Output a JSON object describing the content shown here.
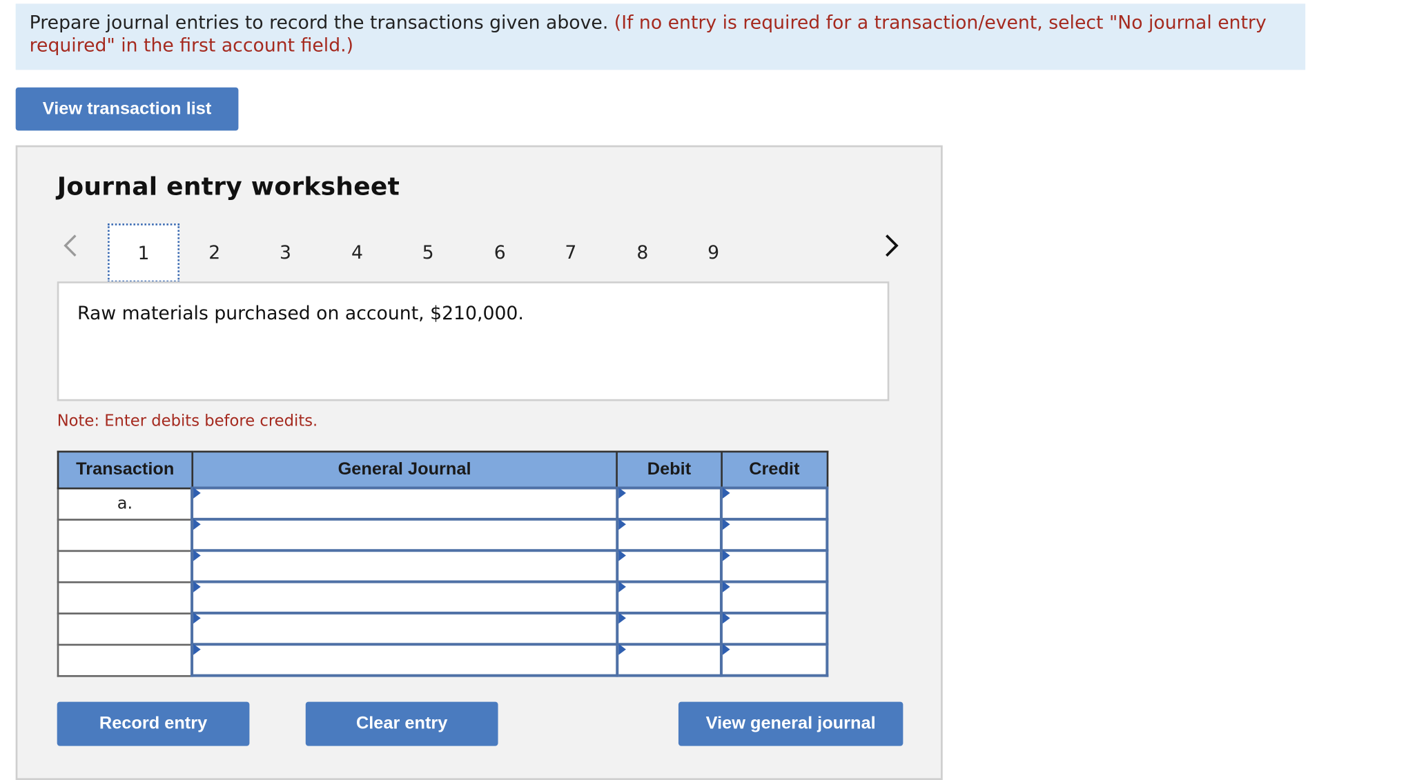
{
  "instructions": {
    "main": "Prepare journal entries to record the transactions given above. ",
    "paren": "(If no entry is required for a transaction/event, select \"No journal entry required\" in the first account field.)"
  },
  "buttons": {
    "view_transaction_list": "View transaction list",
    "record_entry": "Record entry",
    "clear_entry": "Clear entry",
    "view_general_journal": "View general journal"
  },
  "worksheet": {
    "title": "Journal entry worksheet",
    "tabs": [
      "1",
      "2",
      "3",
      "4",
      "5",
      "6",
      "7",
      "8",
      "9"
    ],
    "active_tab": "1",
    "description": "Raw materials purchased on account, $210,000.",
    "note": "Note: Enter debits before credits."
  },
  "journal": {
    "headers": {
      "transaction": "Transaction",
      "general_journal": "General Journal",
      "debit": "Debit",
      "credit": "Credit"
    },
    "rows": [
      {
        "transaction": "a.",
        "account": "",
        "debit": "",
        "credit": ""
      },
      {
        "transaction": "",
        "account": "",
        "debit": "",
        "credit": ""
      },
      {
        "transaction": "",
        "account": "",
        "debit": "",
        "credit": ""
      },
      {
        "transaction": "",
        "account": "",
        "debit": "",
        "credit": ""
      },
      {
        "transaction": "",
        "account": "",
        "debit": "",
        "credit": ""
      },
      {
        "transaction": "",
        "account": "",
        "debit": "",
        "credit": ""
      }
    ]
  },
  "icons": {
    "prev": "chevron-left-icon",
    "next": "chevron-right-icon"
  },
  "colors": {
    "button": "#4a7bbf",
    "instruction_bg": "#dfedf8",
    "note_red": "#a52a1f",
    "header_blue": "#7fa8dd"
  }
}
